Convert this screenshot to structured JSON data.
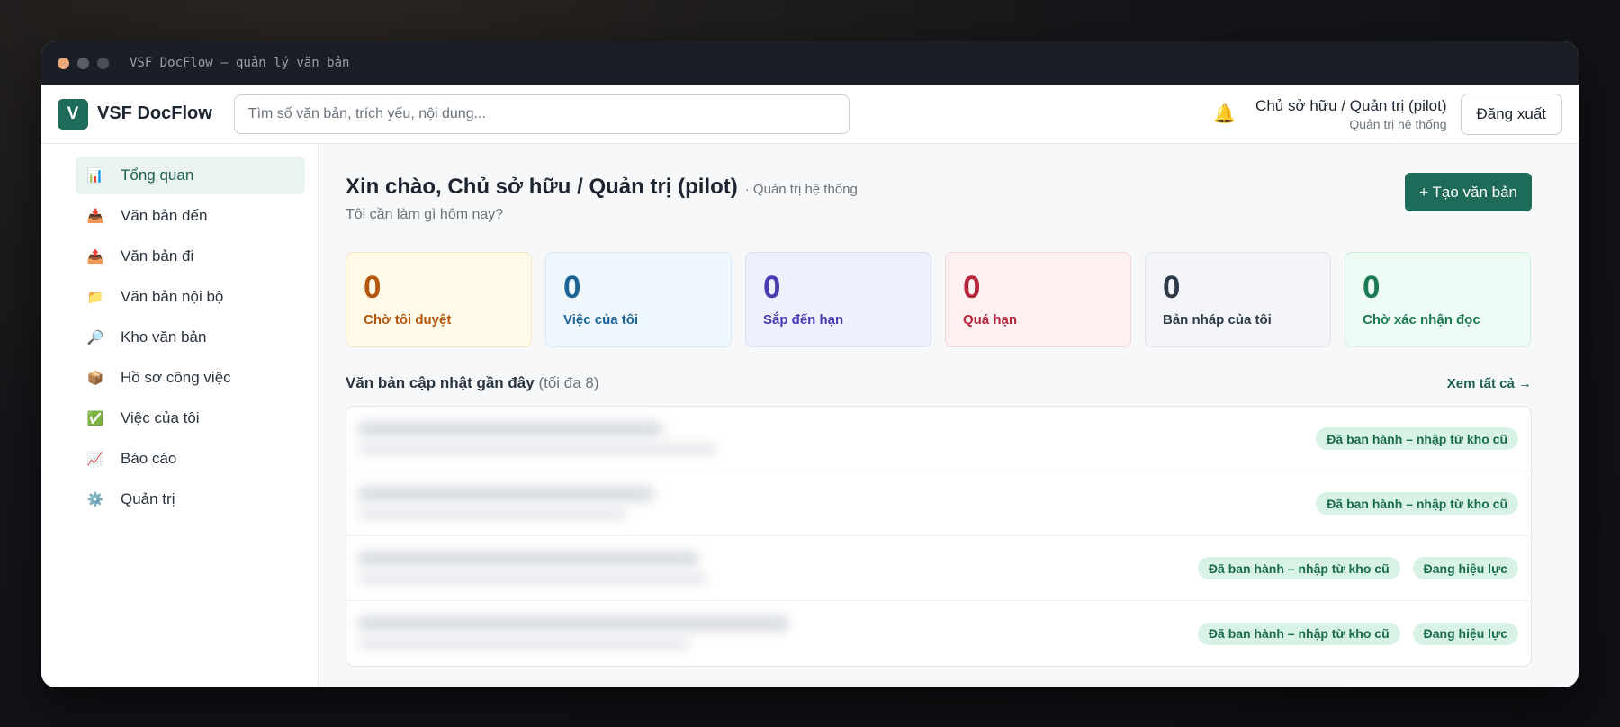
{
  "window": {
    "title": "VSF DocFlow — quản lý văn bản"
  },
  "header": {
    "logo_letter": "V",
    "brand": "VSF DocFlow",
    "search_placeholder": "Tìm số văn bản, trích yếu, nội dung...",
    "bell_icon": "🔔",
    "user_name": "Chủ sở hữu / Quản trị (pilot)",
    "user_role": "Quản trị hệ thống",
    "logout_label": "Đăng xuất"
  },
  "sidebar": {
    "items": [
      {
        "icon": "📊",
        "label": "Tổng quan"
      },
      {
        "icon": "📥",
        "label": "Văn bản đến"
      },
      {
        "icon": "📤",
        "label": "Văn bản đi"
      },
      {
        "icon": "📁",
        "label": "Văn bản nội bộ"
      },
      {
        "icon": "🔎",
        "label": "Kho văn bản"
      },
      {
        "icon": "📦",
        "label": "Hồ sơ công việc"
      },
      {
        "icon": "✅",
        "label": "Việc của tôi"
      },
      {
        "icon": "📈",
        "label": "Báo cáo"
      },
      {
        "icon": "⚙️",
        "label": "Quản trị"
      }
    ]
  },
  "main": {
    "greeting": "Xin chào, Chủ sở hữu / Quản trị (pilot)",
    "greeting_role": "· Quản trị hệ thống",
    "subtitle": "Tôi cần làm gì hôm nay?",
    "create_label": "+ Tạo văn bản",
    "stats": [
      {
        "value": "0",
        "label": "Chờ tôi duyệt"
      },
      {
        "value": "0",
        "label": "Việc của tôi"
      },
      {
        "value": "0",
        "label": "Sắp đến hạn"
      },
      {
        "value": "0",
        "label": "Quá hạn"
      },
      {
        "value": "0",
        "label": "Bản nháp của tôi"
      },
      {
        "value": "0",
        "label": "Chờ xác nhận đọc"
      }
    ],
    "recent_title": "Văn bản cập nhật gần đây",
    "recent_note": "(tối đa 8)",
    "see_all": "Xem tất cả →",
    "rows": [
      {
        "badges": [
          "Đã ban hành – nhập từ kho cũ"
        ]
      },
      {
        "badges": [
          "Đã ban hành – nhập từ kho cũ"
        ]
      },
      {
        "badges": [
          "Đã ban hành – nhập từ kho cũ",
          "Đang hiệu lực"
        ]
      },
      {
        "badges": [
          "Đã ban hành – nhập từ kho cũ",
          "Đang hiệu lực"
        ]
      }
    ]
  }
}
